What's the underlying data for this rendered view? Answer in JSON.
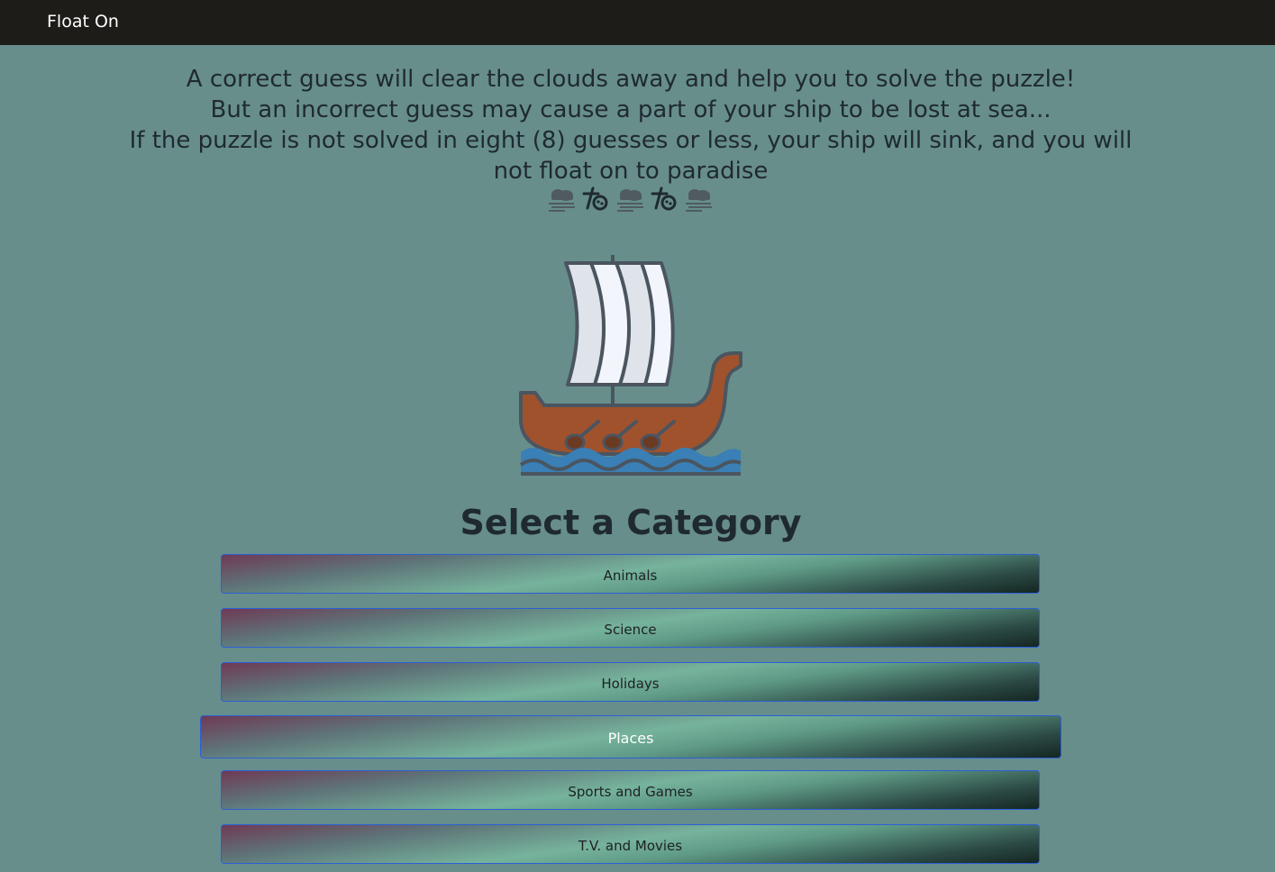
{
  "navbar": {
    "brand": "Float On"
  },
  "intro": {
    "line1": "A correct guess will clear the clouds away and help you to solve the puzzle!",
    "line2": "But an incorrect guess may cause a part of your ship to be lost at sea...",
    "line3": "If the puzzle is not solved in eight (8) guesses or less, your ship will sink, and you will not float on to paradise"
  },
  "weather_icons": [
    "fog-cloud-icon",
    "wind-icon",
    "fog-cloud-icon",
    "wind-icon",
    "fog-cloud-icon"
  ],
  "ship": {
    "icon": "viking-ship-icon"
  },
  "categories": {
    "title": "Select a Category",
    "items": [
      {
        "label": "Animals"
      },
      {
        "label": "Science"
      },
      {
        "label": "Holidays"
      },
      {
        "label": "Places"
      },
      {
        "label": "Sports and Games"
      },
      {
        "label": "T.V. and Movies"
      }
    ],
    "hovered": "Places"
  },
  "colors": {
    "background": "#678e8b",
    "navbar": "#1e1c19",
    "text": "#1f2a30",
    "button_border": "#2c5fd6",
    "hull": "#a0522d",
    "sail": "#eef3fb",
    "water": "#3a7fb5"
  }
}
